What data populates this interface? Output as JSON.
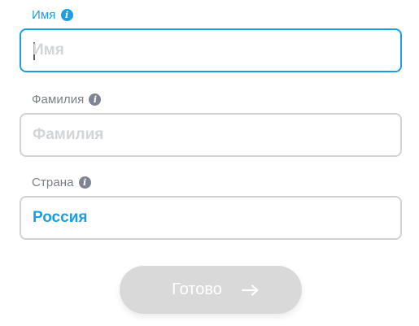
{
  "form": {
    "first_name": {
      "label": "Имя",
      "placeholder": "Имя",
      "value": ""
    },
    "last_name": {
      "label": "Фамилия",
      "placeholder": "Фамилия",
      "value": ""
    },
    "country": {
      "label": "Страна",
      "value": "Россия"
    },
    "submit_label": "Готово"
  },
  "icons": {
    "info": "info-icon",
    "submit_arrow": "arrow-right-icon"
  },
  "colors": {
    "accent": "#1a9ee4",
    "label": "#7b7f86",
    "border": "#cfd2d6",
    "placeholder": "#d2d4d8",
    "button_bg": "#d9d9d9",
    "info_icon": "#7e8491"
  }
}
